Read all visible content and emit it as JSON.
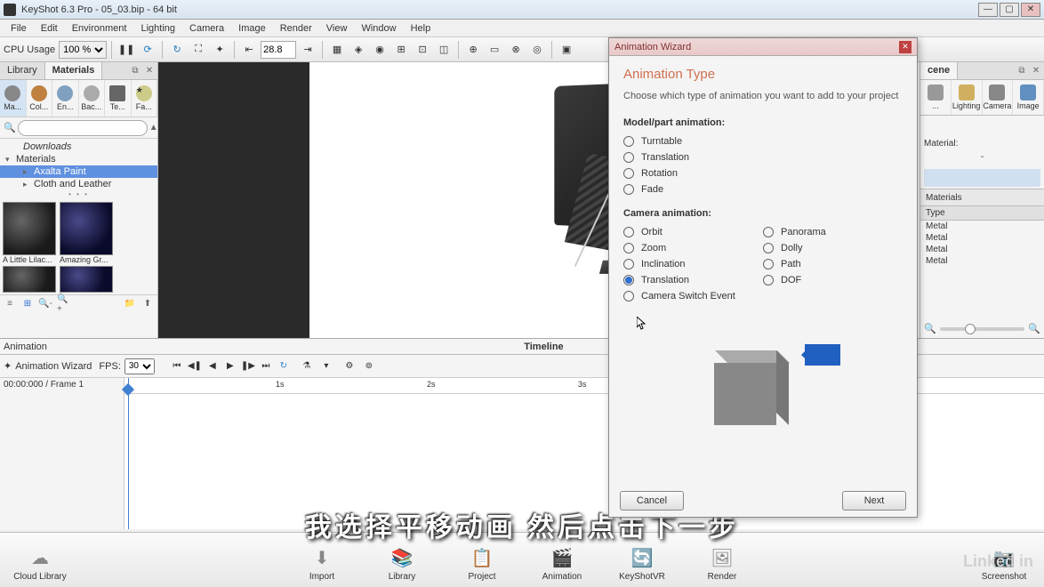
{
  "app": {
    "title": "KeyShot 6.3 Pro  - 05_03.bip - 64 bit"
  },
  "menu": [
    "File",
    "Edit",
    "Environment",
    "Lighting",
    "Camera",
    "Image",
    "Render",
    "View",
    "Window",
    "Help"
  ],
  "toolbar": {
    "cpu_label": "CPU Usage",
    "cpu_value": "100 %",
    "frame_value": "28.8"
  },
  "library": {
    "tab_library": "Library",
    "tab_materials": "Materials",
    "cats": [
      "Ma...",
      "Col...",
      "En...",
      "Bac...",
      "Te...",
      "Fa..."
    ],
    "search_placeholder": "",
    "tree": {
      "downloads": "Downloads",
      "materials": "Materials",
      "axalta": "Axalta Paint",
      "cloth": "Cloth and Leather"
    },
    "thumbs": [
      "A Little Lilac...",
      "Amazing Gr..."
    ]
  },
  "scene": {
    "tab": "cene",
    "tabs": [
      "...",
      "Lighting",
      "Camera",
      "Image"
    ],
    "material_label": "Material:",
    "material_value": "-",
    "sub_tab": "Materials",
    "type_header": "Type",
    "rows": [
      "Metal",
      "Metal",
      "Metal",
      "Metal"
    ]
  },
  "animation": {
    "title": "Animation",
    "timeline_label": "Timeline",
    "wizard_btn": "Animation Wizard",
    "fps_label": "FPS:",
    "fps_value": "30",
    "frame_label": "00:00:000 / Frame 1",
    "ticks": [
      "1s",
      "2s",
      "3s"
    ]
  },
  "bottom": {
    "cloud": "Cloud Library",
    "import": "Import",
    "library": "Library",
    "project": "Project",
    "animation": "Animation",
    "keyshotvr": "KeyShotVR",
    "render": "Render",
    "screenshot": "Screenshot",
    "logo": "Linked in"
  },
  "wizard": {
    "title": "Animation Wizard",
    "heading": "Animation Type",
    "desc": "Choose which type of animation you want to add to your project",
    "model_section": "Model/part animation:",
    "camera_section": "Camera animation:",
    "model_options": [
      "Turntable",
      "Translation",
      "Rotation",
      "Fade"
    ],
    "camera_options_left": [
      "Orbit",
      "Zoom",
      "Inclination",
      "Translation",
      "Camera Switch Event"
    ],
    "camera_options_right": [
      "Panorama",
      "Dolly",
      "Path",
      "DOF"
    ],
    "selected": "Translation",
    "cancel": "Cancel",
    "next": "Next"
  },
  "subtitle": "我选择平移动画 然后点击下一步"
}
